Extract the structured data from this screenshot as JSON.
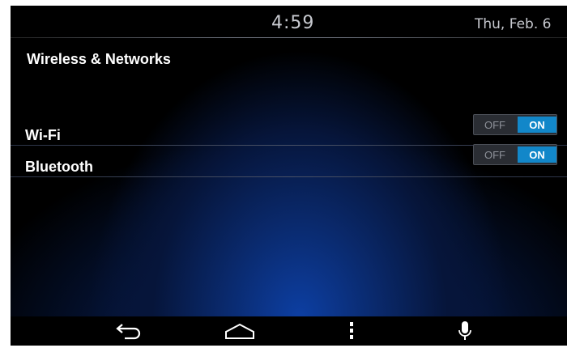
{
  "status_bar": {
    "time": "4:59",
    "date": "Thu, Feb. 6"
  },
  "section": {
    "title": "Wireless & Networks"
  },
  "settings": [
    {
      "label": "Wi-Fi",
      "off_label": "OFF",
      "on_label": "ON",
      "state": "on"
    },
    {
      "label": "Bluetooth",
      "off_label": "OFF",
      "on_label": "ON",
      "state": "on"
    }
  ],
  "nav_bar": {
    "buttons": [
      "back-icon",
      "home-icon",
      "menu-icon",
      "microphone-icon"
    ]
  },
  "colors": {
    "toggle_on": "#1287c9",
    "background_glow": "#0d3fa3"
  }
}
